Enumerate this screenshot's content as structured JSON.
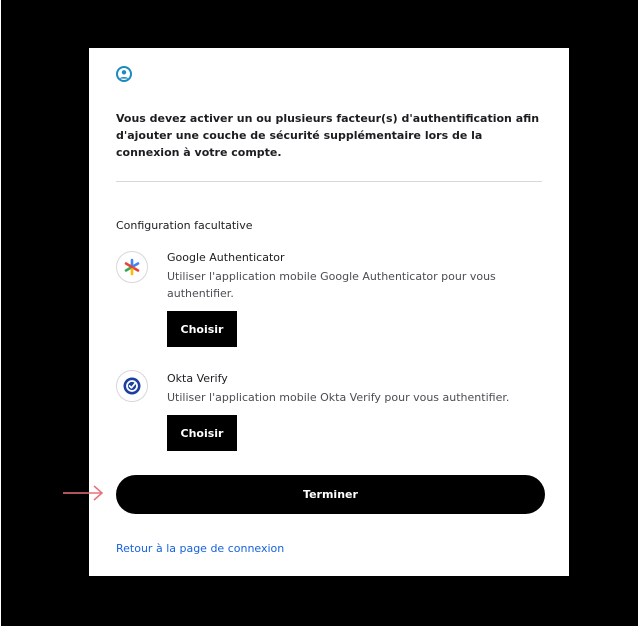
{
  "intro_text": "Vous devez activer un ou plusieurs facteur(s) d'authentification afin d'ajouter une couche de sécurité supplémentaire lors de la connexion à votre compte.",
  "section_title": "Configuration facultative",
  "factors": [
    {
      "name": "Google Authenticator",
      "description": "Utiliser l'application mobile Google Authenticator pour vous authentifier.",
      "button_label": "Choisir",
      "icon": "google-authenticator-icon"
    },
    {
      "name": "Okta Verify",
      "description": "Utiliser l'application mobile Okta Verify pour vous authentifier.",
      "button_label": "Choisir",
      "icon": "okta-verify-icon"
    }
  ],
  "finish_label": "Terminer",
  "back_link": "Retour à la page de connexion",
  "colors": {
    "accent": "#1662dd",
    "user_icon": "#1a8abf",
    "okta": "#1a3fa0",
    "arrow": "#e8707e"
  }
}
